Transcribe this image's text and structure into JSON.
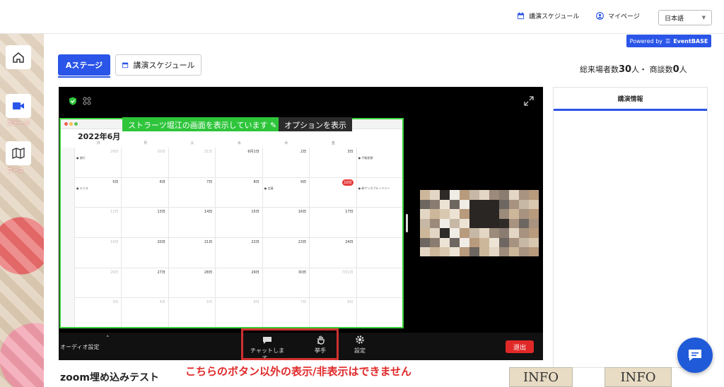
{
  "header": {
    "schedule_link": "講演スケジュール",
    "mypage_link": "マイページ",
    "language": "日本語"
  },
  "powered_by": {
    "prefix": "Powered by",
    "brand": "EventBASE"
  },
  "sidebar": {
    "items": [
      {
        "label": "",
        "icon": "home-icon"
      },
      {
        "label": "ステージ",
        "icon": "video-camera-icon"
      },
      {
        "label": "ブース",
        "icon": "map-icon"
      }
    ]
  },
  "tabs": {
    "stage": "Aステージ",
    "schedule": "講演スケジュール"
  },
  "stats": {
    "visitors_label": "総来場者数",
    "visitors": "30",
    "visitors_unit": "人・",
    "meetings_label": "商談数",
    "meetings": "0",
    "meetings_unit": "人"
  },
  "share": {
    "banner": "ストラーツ堀江の画面を表示しています",
    "options": "オプションを表示"
  },
  "calendar": {
    "month": "2022年6月",
    "weekdays": [
      "日",
      "月",
      "火",
      "水",
      "木",
      "金",
      ""
    ],
    "cells": [
      {
        "d": "29日",
        "m": true,
        "ev": "● 旅行"
      },
      {
        "d": "30日",
        "m": true
      },
      {
        "d": "31日",
        "m": true
      },
      {
        "d": "6月1日"
      },
      {
        "d": "2日"
      },
      {
        "d": "3日"
      },
      {
        "d": "",
        "ev": "● 不動産類"
      },
      {
        "d": "5日",
        "ev": "● テニス"
      },
      {
        "d": "6日"
      },
      {
        "d": "7日"
      },
      {
        "d": "8日"
      },
      {
        "d": "9日",
        "ev": "● 会議"
      },
      {
        "d": "10日",
        "t": true
      },
      {
        "d": "",
        "ev": "● 新サンホブルーベリー"
      },
      {
        "d": "12日",
        "m": true
      },
      {
        "d": "13日"
      },
      {
        "d": "14日"
      },
      {
        "d": "15日"
      },
      {
        "d": "16日"
      },
      {
        "d": "17日"
      },
      {
        "d": ""
      },
      {
        "d": "19日",
        "m": true
      },
      {
        "d": "20日"
      },
      {
        "d": "21日"
      },
      {
        "d": "22日"
      },
      {
        "d": "23日"
      },
      {
        "d": "24日"
      },
      {
        "d": ""
      },
      {
        "d": "26日",
        "m": true
      },
      {
        "d": "27日"
      },
      {
        "d": "28日"
      },
      {
        "d": "29日"
      },
      {
        "d": "30日"
      },
      {
        "d": "7月1日",
        "m": true
      },
      {
        "d": ""
      },
      {
        "d": "3日",
        "m": true
      },
      {
        "d": "4日",
        "m": true
      },
      {
        "d": "5日",
        "m": true
      },
      {
        "d": "6日",
        "m": true
      },
      {
        "d": "7日",
        "m": true
      },
      {
        "d": "8日",
        "m": true
      },
      {
        "d": ""
      }
    ]
  },
  "controls": {
    "audio": "オーディオ設定",
    "chat": "チャットします。",
    "raise_hand": "挙手",
    "settings": "設定",
    "exit": "退出"
  },
  "panel": {
    "title": "講演情報"
  },
  "caption": "こちらのボタン以外の表示/非表示はできません",
  "zoom_title": "zoom埋め込みテスト",
  "info_blocks": [
    "INFO",
    "INFO"
  ],
  "colors": {
    "accent": "#2a55e8",
    "share_green": "#2ec53b",
    "danger": "#e02828"
  }
}
